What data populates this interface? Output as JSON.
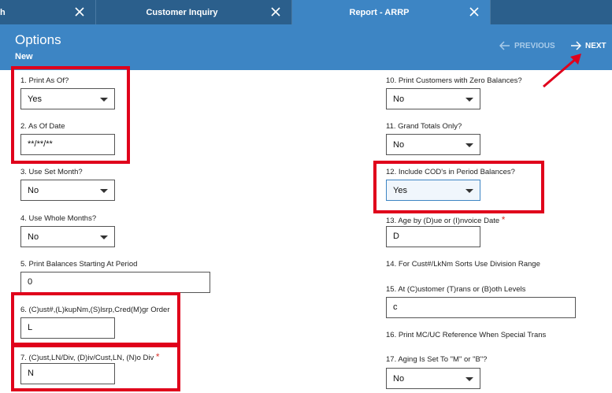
{
  "tabs": [
    {
      "label": "h"
    },
    {
      "label": "Customer Inquiry"
    },
    {
      "label": "Report - ARRP"
    },
    {
      "label": ""
    }
  ],
  "header": {
    "title": "Options",
    "subtitle": "New",
    "previous_label": "PREVIOUS",
    "next_label": "NEXT"
  },
  "fields": {
    "f1": {
      "label": "1. Print As Of?",
      "value": "Yes"
    },
    "f2": {
      "label": "2.  As Of Date",
      "value": "**/**/**"
    },
    "f3": {
      "label": "3.  Use Set Month?",
      "value": "No"
    },
    "f4": {
      "label": "4. Use Whole Months?",
      "value": "No"
    },
    "f5": {
      "label": "5. Print Balances Starting At Period",
      "value": "0"
    },
    "f6": {
      "label": "6. (C)ust#,(L)kupNm,(S)lsrp,Cred(M)gr Order",
      "value": "L"
    },
    "f7": {
      "label": "7.  (C)ust,LN/Div, (D)iv/Cust,LN, (N)o Div",
      "required": "*",
      "value": "N"
    },
    "f10": {
      "label": "10. Print Customers with Zero Balances?",
      "value": "No"
    },
    "f11": {
      "label": "11. Grand Totals Only?",
      "value": "No"
    },
    "f12": {
      "label": "12. Include COD's in Period Balances?",
      "value": "Yes"
    },
    "f13": {
      "label": "13. Age by (D)ue or (I)nvoice Date",
      "required": "*",
      "value": "D"
    },
    "f14": {
      "label": "14. For Cust#/LkNm Sorts Use Division Range"
    },
    "f15": {
      "label": "15.  At (C)ustomer (T)rans or (B)oth Levels",
      "value": "c"
    },
    "f16": {
      "label": "16. Print MC/UC Reference When Special Trans"
    },
    "f17": {
      "label": "17.  Aging Is Set To \"M\" or \"B\"?",
      "value": "No"
    }
  },
  "colors": {
    "tabbar": "#2b5f8c",
    "header": "#3d85c4",
    "annotation": "#e0001b"
  }
}
